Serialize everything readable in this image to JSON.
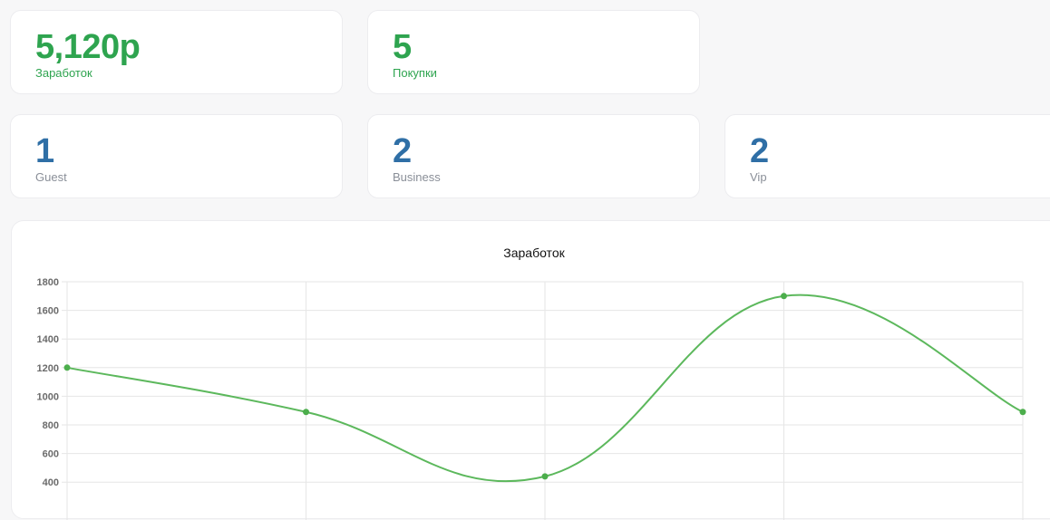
{
  "stats_top": [
    {
      "value": "5,120р",
      "label": "Заработок"
    },
    {
      "value": "5",
      "label": "Покупки"
    }
  ],
  "stats_bottom": [
    {
      "value": "1",
      "label": "Guest"
    },
    {
      "value": "2",
      "label": "Business"
    },
    {
      "value": "2",
      "label": "Vip"
    }
  ],
  "colors": {
    "green": "#2ea44f",
    "blue": "#2f6fa6",
    "line": "#5cb85c"
  },
  "chart_data": {
    "type": "line",
    "title": "Заработок",
    "xlabel": "",
    "ylabel": "",
    "ylim": [
      200,
      1800
    ],
    "yticks": [
      400,
      600,
      800,
      1000,
      1200,
      1400,
      1600,
      1800
    ],
    "series": [
      {
        "values": [
          1200,
          890,
          440,
          1700,
          890
        ]
      }
    ],
    "grid": true
  }
}
